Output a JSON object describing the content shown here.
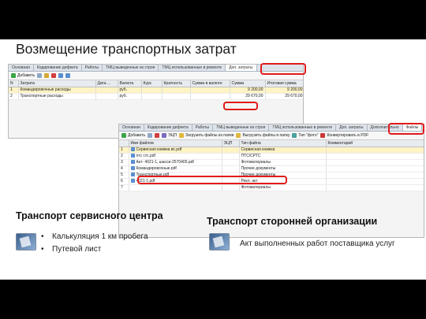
{
  "title": "Возмещение транспортных затрат",
  "window1": {
    "tabs": [
      "Основная",
      "Кодирование дефекта",
      "Работы",
      "ТМЦ выведенные из строя",
      "ТМЦ использованные в ремонте",
      "Доп. затраты"
    ],
    "active_tab": 5,
    "toolbar": {
      "add_label": "Добавить"
    },
    "columns": [
      "N",
      "Затрата",
      "Дата ...",
      "Валюта",
      "Курс",
      "Кратность",
      "Сумма в валюте",
      "Сумма",
      "Итоговая сумма"
    ],
    "rows": [
      [
        "1",
        "Командировочные расходы",
        "",
        "руб.",
        "",
        "",
        "",
        "9 200,00",
        "9 200,00"
      ],
      [
        "2",
        "Транспортные расходы",
        "",
        "руб.",
        "",
        "",
        "",
        "29 670,00",
        "29 670,00"
      ]
    ]
  },
  "window2": {
    "tabs": [
      "Основная",
      "Кодирование дефекта",
      "Работы",
      "ТМЦ выведенные из строя",
      "ТМЦ использованные в ремонте",
      "Доп. затраты",
      "Дополнительно",
      "Файлы"
    ],
    "active_tab": 7,
    "toolbar": {
      "add_label": "Добавить",
      "edit_label": "ЭЦП",
      "load_label": "Загрузить файлы из папки",
      "unload_label": "Выгрузить файлы в папку",
      "type_label": "Тип \"фото\"",
      "convert_label": "Конвертировать в PDF"
    },
    "columns": [
      "",
      "Имя файлов",
      "ЭЦП",
      "Тип файла",
      "Комментарий"
    ],
    "rows": [
      [
        "1",
        "Сервисная книжка вс.pdf",
        "",
        "Сервисная книжка",
        ""
      ],
      [
        "2",
        "птс стс.pdf",
        "",
        "ПТС/СРТС",
        ""
      ],
      [
        "3",
        "Акт- 4021-1, шасси-2570405.pdf",
        "",
        "Фотоматериалы",
        ""
      ],
      [
        "4",
        "Командировочные.pdf",
        "",
        "Прочие документы",
        ""
      ],
      [
        "5",
        "Транспортные.pdf",
        "",
        "Прочие документы",
        ""
      ],
      [
        "6",
        "4021-1.pdf",
        "",
        "Рекл. акт",
        ""
      ],
      [
        "7",
        "",
        "",
        "Фотоматериалы",
        ""
      ]
    ]
  },
  "section1": {
    "title": "Транспорт сервисного центра",
    "bullets": [
      "Калькуляция 1 км пробега",
      "Путевой лист"
    ]
  },
  "section2": {
    "title": "Транспорт сторонней организации",
    "text": "Акт выполненных работ поставщика услуг"
  },
  "colors": {
    "highlight": "#e01a1a",
    "selected_row": "#fdf3c4",
    "tab_bar": "#dde3ea"
  }
}
